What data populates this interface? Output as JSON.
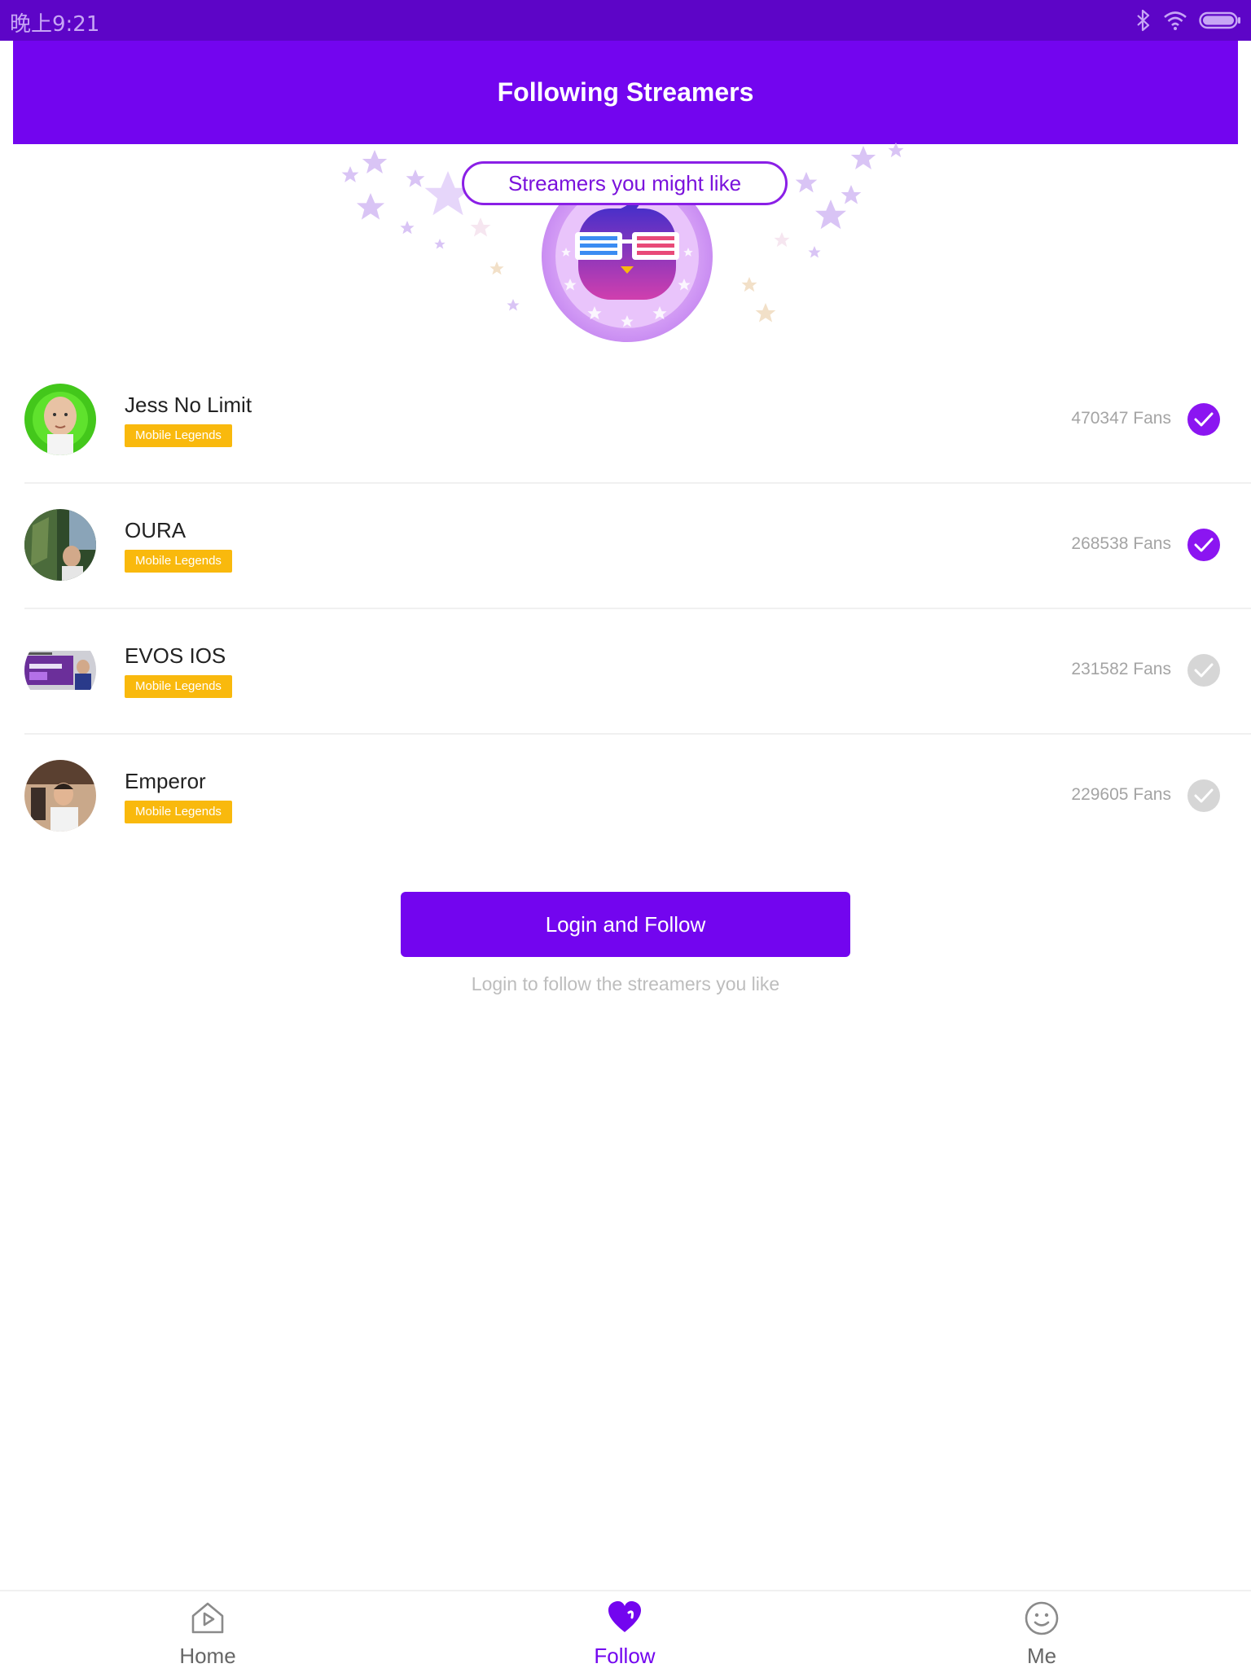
{
  "status_bar": {
    "time": "晚上9:21",
    "icons": [
      "bluetooth-icon",
      "wifi-icon",
      "battery-icon"
    ]
  },
  "header": {
    "title": "Following Streamers"
  },
  "hero": {
    "bubble_text": "Streamers you might like",
    "mascot": "mascot-glasses-icon"
  },
  "streamers": [
    {
      "name": "Jess No Limit",
      "game": "Mobile Legends",
      "fans": "470347 Fans",
      "selected": true
    },
    {
      "name": "OURA",
      "game": "Mobile Legends",
      "fans": "268538 Fans",
      "selected": true
    },
    {
      "name": "EVOS IOS",
      "game": "Mobile Legends",
      "fans": "231582 Fans",
      "selected": false
    },
    {
      "name": "Emperor",
      "game": "Mobile Legends",
      "fans": "229605 Fans",
      "selected": false
    }
  ],
  "login": {
    "button_label": "Login and Follow",
    "hint": "Login to follow the streamers you like"
  },
  "bottom_nav": {
    "items": [
      {
        "label": "Home",
        "icon": "home-icon",
        "active": false
      },
      {
        "label": "Follow",
        "icon": "heart-icon",
        "active": true
      },
      {
        "label": "Me",
        "icon": "smiley-icon",
        "active": false
      }
    ]
  },
  "colors": {
    "primary": "#7305ef",
    "status_bar": "#5d05c7",
    "badge": "#f9b90d",
    "check_on": "#8b15f1",
    "check_off": "#d6d6d6"
  }
}
